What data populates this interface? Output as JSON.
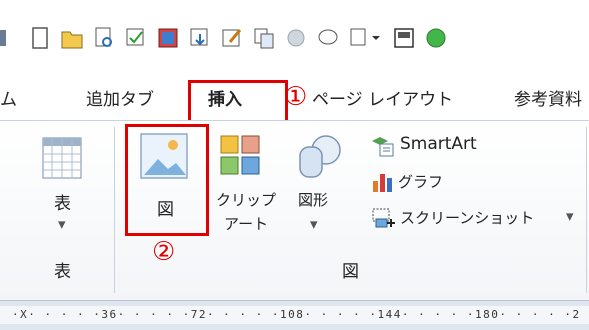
{
  "quick_access_toolbar": {
    "icons": [
      "new-document-icon",
      "open-folder-icon",
      "print-preview-icon",
      "spelling-icon",
      "table-icon",
      "save-icon",
      "draw-table-icon",
      "copy-icon",
      "circle-icon",
      "comment-icon",
      "dropdown-icon",
      "image-window-icon",
      "green-orb-icon"
    ]
  },
  "tabs": {
    "partial_left": "ム",
    "addin": "追加タブ",
    "insert": "挿入",
    "page_layout": "ページ レイアウト",
    "references": "参考資料"
  },
  "ribbon": {
    "table_group": {
      "button_label": "表",
      "dropdown_glyph": "▾",
      "group_label": "表"
    },
    "illustrations_group": {
      "picture_label": "図",
      "clipart_label_line1": "クリップ",
      "clipart_label_line2": "アート",
      "shapes_label": "図形",
      "shapes_dropdown": "▾",
      "smartart_label": "SmartArt",
      "chart_label": "グラフ",
      "screenshot_label": "スクリーンショット",
      "screenshot_dropdown": "▾",
      "group_label": "図"
    }
  },
  "annotations": {
    "step1": "①",
    "step2": "②",
    "highlight_color": "#e00000"
  },
  "ruler": {
    "text": "·X· · · · ·36· · · · ·72· · · · ·108· · · · ·144· · · · ·180· · · · ·2"
  }
}
